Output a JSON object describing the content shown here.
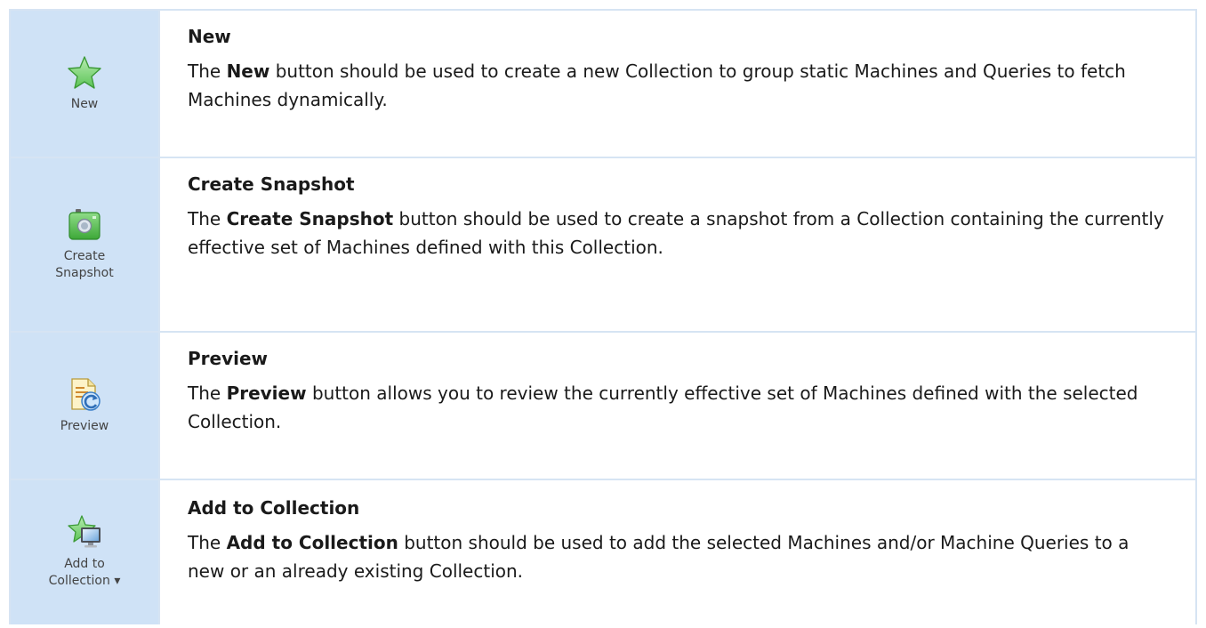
{
  "rows": [
    {
      "icon": "star-icon",
      "button_label": "New",
      "title": "New",
      "desc_prefix": "The ",
      "desc_bold": "New",
      "desc_suffix": " button should be used to create a new Collection to group static Machines and Queries to fetch Machines dynamically."
    },
    {
      "icon": "camera-icon",
      "button_label": "Create\nSnapshot",
      "title": "Create Snapshot",
      "desc_prefix": "The ",
      "desc_bold": "Create Snapshot",
      "desc_suffix": " button should be used to create a snapshot from a Collection containing the currently effective set of Machines defined with this Collection."
    },
    {
      "icon": "preview-icon",
      "button_label": "Preview",
      "title": "Preview",
      "desc_prefix": "The ",
      "desc_bold": "Preview",
      "desc_suffix": " button allows you to review the currently effective set of Machines defined with the selected Collection."
    },
    {
      "icon": "star-monitor-icon",
      "button_label": "Add to\nCollection ▾",
      "title": "Add to Collection",
      "desc_prefix": "The ",
      "desc_bold": "Add to Collection",
      "desc_suffix": " button should be used to add the selected Machines and/or Machine Queries to a new or an already existing Collection."
    }
  ],
  "colors": {
    "icon_cell_bg": "#cfe2f6",
    "border": "#d6e4f3",
    "star_green": "#7ed37a",
    "camera_green": "#4fb84a"
  }
}
